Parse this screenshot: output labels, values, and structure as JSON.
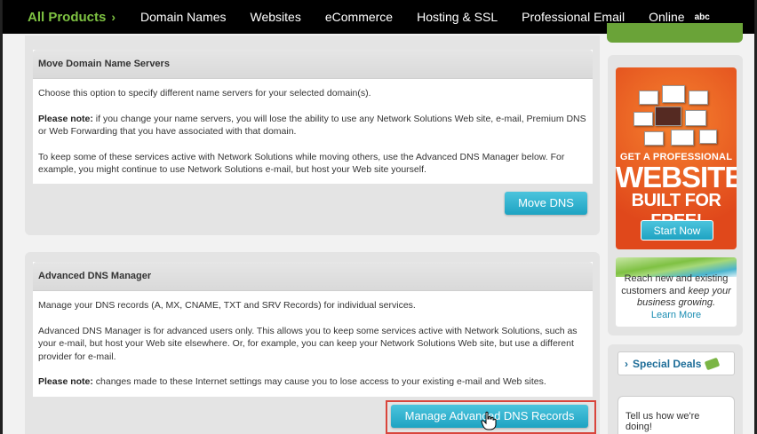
{
  "nav": {
    "all_products": "All Products",
    "items": [
      "Domain Names",
      "Websites",
      "eCommerce",
      "Hosting & SSL",
      "Professional Email",
      "Online"
    ],
    "trailing": "abc"
  },
  "move_dns": {
    "title": "Move Domain Name Servers",
    "intro": "Choose this option to specify different name servers for your selected domain(s).",
    "note_label": "Please note:",
    "note_text": " if you change your name servers, you will lose the ability to use any Network Solutions Web site, e-mail, Premium DNS or Web Forwarding that you have associated with that domain.",
    "extra": "To keep some of these services active with Network Solutions while moving others, use the Advanced DNS Manager below. For example, you might continue to use Network Solutions e-mail, but host your Web site yourself.",
    "button": "Move DNS"
  },
  "adv_dns": {
    "title": "Advanced DNS Manager",
    "intro": "Manage your DNS records (A, MX, CNAME, TXT and SRV Records) for individual services.",
    "detail": "Advanced DNS Manager is for advanced users only. This allows you to keep some services active with Network Solutions, such as your e-mail, but host your Web site elsewhere. Or, for example, you can keep your Network Solutions Web site, but use a different provider for e-mail.",
    "note_label": "Please note:",
    "note_text": " changes made to these Internet settings may cause you to lose access to your existing e-mail and Web sites.",
    "button": "Manage Advanced DNS Records"
  },
  "sidebar": {
    "ad": {
      "line1": "GET A PROFESSIONAL",
      "line2": "WEBSITE",
      "line3": "BUILT FOR FREE!",
      "button": "Start Now"
    },
    "reach": {
      "line1": "Reach new and existing",
      "line2a": "customers and ",
      "line2b": "keep your",
      "line3": "business growing.",
      "link": "Learn More"
    },
    "special_deals": "Special Deals",
    "tell_us": "Tell us how we're doing!"
  },
  "colors": {
    "nav_bg": "#000000",
    "nav_accent": "#7ec242",
    "button": "#1ea3c2",
    "highlight_outline": "#d9453c",
    "ad_orange": "#e0481b"
  }
}
